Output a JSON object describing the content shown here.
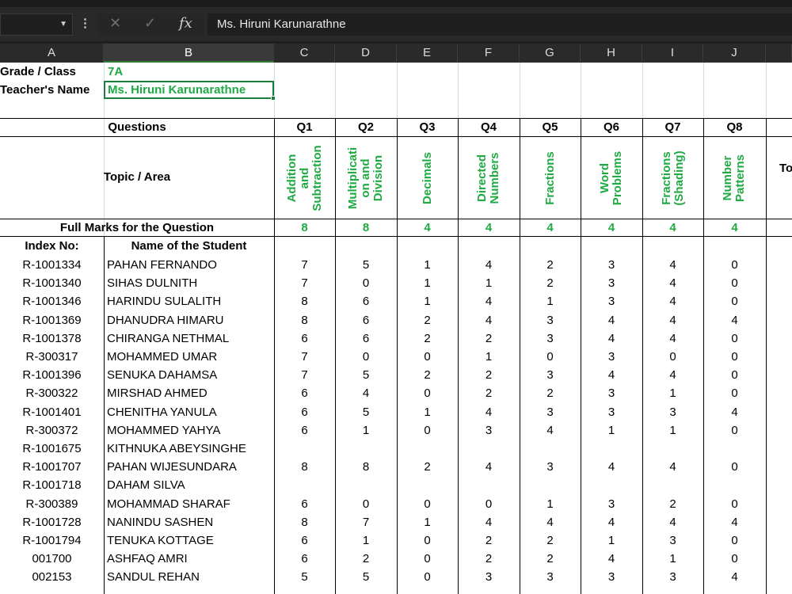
{
  "formula_bar": {
    "formula": "Ms. Hiruni Karunarathne",
    "icons": [
      "chevron-down-icon",
      "more-vertical-icon",
      "cancel-icon",
      "enter-icon",
      "function-icon"
    ]
  },
  "columns": [
    "A",
    "B",
    "C",
    "D",
    "E",
    "F",
    "G",
    "H",
    "I",
    "J"
  ],
  "info": {
    "grade_label": "Grade / Class",
    "grade_value": "7A",
    "teacher_label": "Teacher's Name",
    "teacher_value": "Ms. Hiruni Karunarathne"
  },
  "table": {
    "questions_label": "Questions",
    "question_headers": [
      "Q1",
      "Q2",
      "Q3",
      "Q4",
      "Q5",
      "Q6",
      "Q7",
      "Q8"
    ],
    "topic_label": "Topic / Area",
    "topics": [
      "Addition\nand\nSubtraction",
      "Multiplicati\non and\nDivision",
      "Decimals",
      "Directed\nNumbers",
      "Fractions",
      "Word\nProblems",
      "Fractions\n(Shading)",
      "Number\nPatterns"
    ],
    "total_header_partial": "To",
    "full_marks_label": "Full Marks for the Question",
    "full_marks": [
      "8",
      "8",
      "4",
      "4",
      "4",
      "4",
      "4",
      "4"
    ],
    "index_header": "Index No:",
    "name_header": "Name of the Student"
  },
  "students": [
    {
      "index": "R-1001334",
      "name": "PAHAN FERNANDO",
      "marks": [
        "7",
        "5",
        "1",
        "4",
        "2",
        "3",
        "4",
        "0"
      ]
    },
    {
      "index": "R-1001340",
      "name": "SIHAS DULNITH",
      "marks": [
        "7",
        "0",
        "1",
        "1",
        "2",
        "3",
        "4",
        "0"
      ]
    },
    {
      "index": "R-1001346",
      "name": "HARINDU SULALITH",
      "marks": [
        "8",
        "6",
        "1",
        "4",
        "1",
        "3",
        "4",
        "0"
      ]
    },
    {
      "index": "R-1001369",
      "name": "DHANUDRA HIMARU",
      "marks": [
        "8",
        "6",
        "2",
        "4",
        "3",
        "4",
        "4",
        "4"
      ]
    },
    {
      "index": "R-1001378",
      "name": "CHIRANGA NETHMAL",
      "marks": [
        "6",
        "6",
        "2",
        "2",
        "3",
        "4",
        "4",
        "0"
      ]
    },
    {
      "index": "R-300317",
      "name": "MOHAMMED UMAR",
      "marks": [
        "7",
        "0",
        "0",
        "1",
        "0",
        "3",
        "0",
        "0"
      ]
    },
    {
      "index": "R-1001396",
      "name": "SENUKA DAHAMSA",
      "marks": [
        "7",
        "5",
        "2",
        "2",
        "3",
        "4",
        "4",
        "0"
      ]
    },
    {
      "index": "R-300322",
      "name": "MIRSHAD AHMED",
      "marks": [
        "6",
        "4",
        "0",
        "2",
        "2",
        "3",
        "1",
        "0"
      ]
    },
    {
      "index": "R-1001401",
      "name": "CHENITHA  YANULA",
      "marks": [
        "6",
        "5",
        "1",
        "4",
        "3",
        "3",
        "3",
        "4"
      ]
    },
    {
      "index": "R-300372",
      "name": "MOHAMMED YAHYA",
      "marks": [
        "6",
        "1",
        "0",
        "3",
        "4",
        "1",
        "1",
        "0"
      ]
    },
    {
      "index": "R-1001675",
      "name": "KITHNUKA ABEYSINGHE",
      "marks": [
        "",
        "",
        "",
        "",
        "",
        "",
        "",
        ""
      ]
    },
    {
      "index": "R-1001707",
      "name": "PAHAN  WIJESUNDARA",
      "marks": [
        "8",
        "8",
        "2",
        "4",
        "3",
        "4",
        "4",
        "0"
      ]
    },
    {
      "index": "R-1001718",
      "name": "DAHAM SILVA",
      "marks": [
        "",
        "",
        "",
        "",
        "",
        "",
        "",
        ""
      ]
    },
    {
      "index": "R-300389",
      "name": "MOHAMMAD SHARAF",
      "marks": [
        "6",
        "0",
        "0",
        "0",
        "1",
        "3",
        "2",
        "0"
      ]
    },
    {
      "index": "R-1001728",
      "name": "NANINDU SASHEN",
      "marks": [
        "8",
        "7",
        "1",
        "4",
        "4",
        "4",
        "4",
        "4"
      ]
    },
    {
      "index": "R-1001794",
      "name": "TENUKA  KOTTAGE",
      "marks": [
        "6",
        "1",
        "0",
        "2",
        "2",
        "1",
        "3",
        "0"
      ]
    },
    {
      "index": "001700",
      "name": "ASHFAQ AMRI",
      "marks": [
        "6",
        "2",
        "0",
        "2",
        "2",
        "4",
        "1",
        "0"
      ]
    },
    {
      "index": "002153",
      "name": "SANDUL REHAN",
      "marks": [
        "5",
        "5",
        "0",
        "3",
        "3",
        "3",
        "3",
        "4"
      ]
    }
  ]
}
